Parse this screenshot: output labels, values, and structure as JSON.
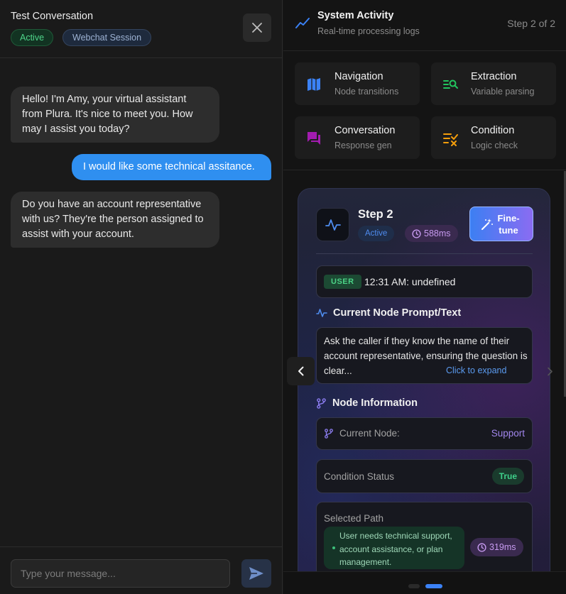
{
  "conversation": {
    "title": "Test Conversation",
    "status_badge": "Active",
    "session_badge": "Webchat Session",
    "close_icon": "close-icon"
  },
  "messages": [
    {
      "role": "assistant",
      "text": "Hello! I'm Amy, your virtual assistant from Plura. It's nice to meet you. How may I assist you today?"
    },
    {
      "role": "user",
      "text": "I would like some technical assitance."
    },
    {
      "role": "assistant",
      "text": "Do you have an account representative with us? They're the person assigned to assist with your account."
    }
  ],
  "composer": {
    "placeholder": "Type your message...",
    "value": "",
    "send_icon": "send-icon"
  },
  "activity": {
    "title": "System Activity",
    "subtitle": "Real-time processing logs",
    "step_counter": "Step 2 of 2",
    "icon": "trending-line-icon"
  },
  "event_types": [
    {
      "name": "Navigation",
      "desc": "Node transitions",
      "icon": "map-icon",
      "color": "#3b82f6"
    },
    {
      "name": "Extraction",
      "desc": "Variable parsing",
      "icon": "list-search-icon",
      "color": "#22c55e"
    },
    {
      "name": "Conversation",
      "desc": "Response gen",
      "icon": "chat-bubbles-icon",
      "color": "#a21caf"
    },
    {
      "name": "Condition",
      "desc": "Logic check",
      "icon": "list-check-icon",
      "color": "#f59e0b"
    }
  ],
  "step": {
    "title": "Step 2",
    "status": "Active",
    "duration": "588ms",
    "fine_tune_label": "Fine-tune",
    "user_tag": "USER",
    "user_text": "12:31 AM: undefined",
    "prompt_heading": "Current Node Prompt/Text",
    "prompt_text": "Ask the caller if they know the name of their account representative, ensuring the question is clear...",
    "expand_label": "Click to expand",
    "node_heading": "Node Information",
    "current_node_label": "Current Node:",
    "current_node_value": "Support",
    "condition_label": "Condition Status",
    "condition_value": "True",
    "path_label": "Selected Path",
    "path_text": "User needs technical support, account assistance, or plan management.",
    "path_duration": "319ms"
  },
  "pager": {
    "pages": 2,
    "current": 2
  },
  "colors": {
    "accent_blue": "#2f8ff0",
    "active_green": "#4fd58a",
    "purple": "#c79af0"
  }
}
